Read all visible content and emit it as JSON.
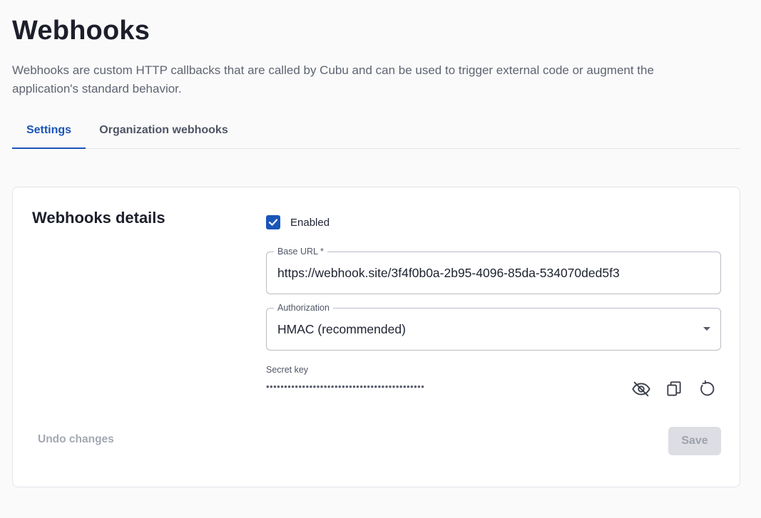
{
  "page": {
    "title": "Webhooks",
    "description": "Webhooks are custom HTTP callbacks that are called by Cubu and can be used to trigger external code or augment the application's standard behavior."
  },
  "tabs": [
    {
      "label": "Settings",
      "active": true
    },
    {
      "label": "Organization webhooks",
      "active": false
    }
  ],
  "card": {
    "title": "Webhooks details",
    "enabled": {
      "label": "Enabled",
      "checked": true
    },
    "base_url": {
      "label": "Base URL *",
      "value": "https://webhook.site/3f4f0b0a-2b95-4096-85da-534070ded5f3"
    },
    "authorization": {
      "label": "Authorization",
      "value": "HMAC (recommended)"
    },
    "secret_key": {
      "label": "Secret key",
      "value": "••••••••••••••••••••••••••••••••••••••••••••"
    },
    "icons": {
      "visibility": "eye-off-icon",
      "copy": "copy-icon",
      "regenerate": "refresh-icon"
    },
    "undo_label": "Undo changes",
    "save_label": "Save"
  },
  "colors": {
    "accent": "#1a55b8",
    "disabled_text": "#a4a8b2",
    "disabled_bg": "#dcdee3"
  }
}
